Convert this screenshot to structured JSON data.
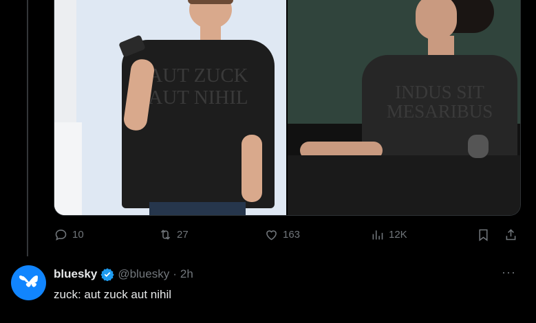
{
  "action_bar": {
    "reply_count": "10",
    "repost_count": "27",
    "like_count": "163",
    "views_count": "12K"
  },
  "media": {
    "left_shirt_line1": "AUT ZUCK",
    "left_shirt_line2": "AUT NIHIL",
    "right_shirt_line1": "INDUS SIT",
    "right_shirt_line2": "MESARIBUS"
  },
  "tweet": {
    "author_name": "bluesky",
    "author_handle": "@bluesky",
    "separator": "·",
    "time": "2h",
    "text": "zuck: aut zuck aut nihil",
    "more_label": "···"
  },
  "colors": {
    "background": "#000000",
    "muted": "#71767b",
    "text": "#e7e9ea",
    "verified": "#1d9bf0",
    "bluesky_brand": "#1185fe"
  },
  "icons": [
    "reply-icon",
    "repost-icon",
    "like-icon",
    "views-icon",
    "bookmark-icon",
    "share-icon",
    "verified-badge-icon",
    "butterfly-icon",
    "more-icon"
  ]
}
